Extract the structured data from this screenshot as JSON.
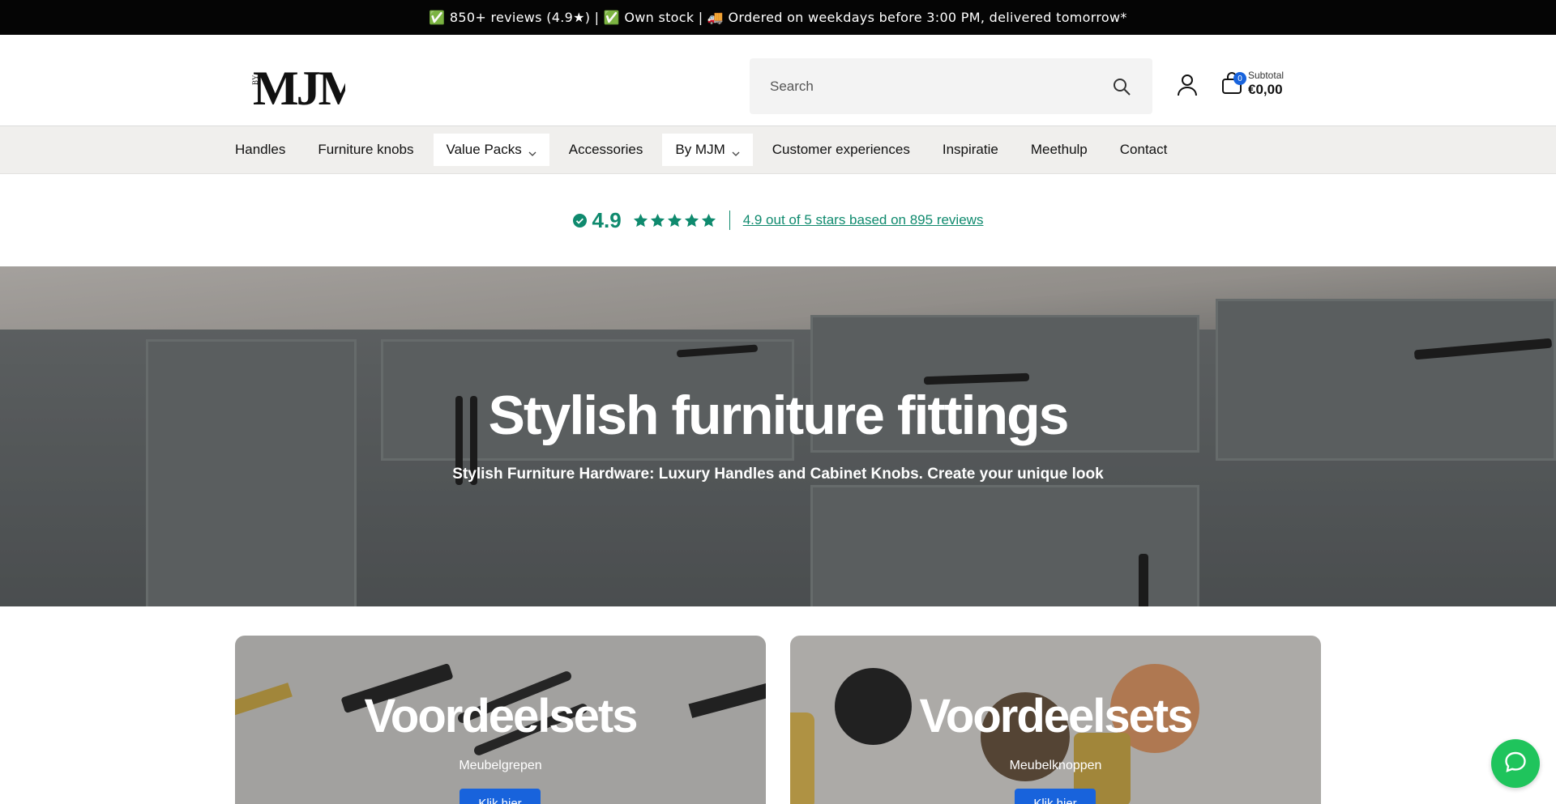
{
  "announcement": {
    "text": "✅ 850+ reviews (4.9★) | ✅ Own stock | 🚚 Ordered on weekdays before 3:00 PM, delivered tomorrow*"
  },
  "header": {
    "logo_text": "MJM",
    "logo_prefix": "BY",
    "search": {
      "placeholder": "Search"
    },
    "cart": {
      "count": "0",
      "subtotal_label": "Subtotal",
      "subtotal_value": "€0,00"
    }
  },
  "nav": {
    "items": [
      {
        "label": "Handles"
      },
      {
        "label": "Furniture knobs"
      },
      {
        "label": "Value Packs"
      },
      {
        "label": "Accessories"
      },
      {
        "label": "By MJM"
      },
      {
        "label": "Customer experiences"
      },
      {
        "label": "Inspiratie"
      },
      {
        "label": "Meethulp"
      },
      {
        "label": "Contact"
      }
    ]
  },
  "rating": {
    "score": "4.9",
    "stars": 5,
    "link_text": "4.9 out of 5 stars based on 895 reviews",
    "color": "#0f8a6e"
  },
  "hero": {
    "title": "Stylish furniture fittings",
    "subtitle": "Stylish Furniture Hardware: Luxury Handles and Cabinet Knobs. Create your unique look"
  },
  "cards": [
    {
      "title": "Voordeelsets",
      "subtitle": "Meubelgrepen",
      "button": "Klik hier"
    },
    {
      "title": "Voordeelsets",
      "subtitle": "Meubelknoppen",
      "button": "Klik hier"
    }
  ],
  "chat": {
    "icon": "chat-bubble-icon",
    "color": "#1fc45c"
  },
  "colors": {
    "accent": "#1863dc",
    "announcement_bg": "#050505"
  }
}
